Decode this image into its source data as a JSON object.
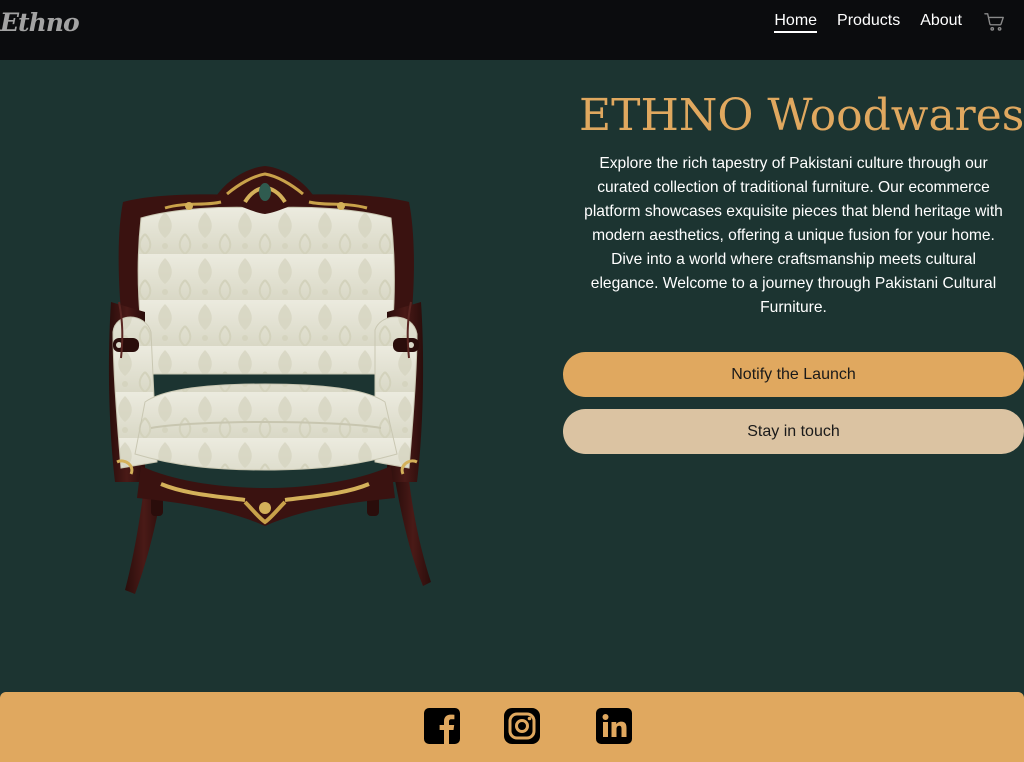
{
  "nav": {
    "logo": "Ethno",
    "links": [
      {
        "label": "Home",
        "active": true
      },
      {
        "label": "Products",
        "active": false
      },
      {
        "label": "About",
        "active": false
      }
    ],
    "cart_icon": "cart-icon"
  },
  "hero": {
    "title": "ETHNO Woodwares",
    "description": "Explore the rich tapestry of Pakistani culture through our curated collection of traditional furniture. Our ecommerce platform showcases exquisite pieces that blend heritage with modern aesthetics, offering a unique fusion for your home. Dive into a world where craftsmanship meets cultural elegance. Welcome to a journey through Pakistani Cultural Furniture.",
    "image_subject": "ornate-armchair",
    "buttons": {
      "notify": "Notify the Launch",
      "touch": "Stay in touch"
    }
  },
  "footer": {
    "socials": [
      "facebook-icon",
      "instagram-icon",
      "linkedin-icon"
    ]
  },
  "colors": {
    "nav_bg": "#0b0c0e",
    "page_bg": "#1c3431",
    "accent": "#e0a85f",
    "button_secondary": "#dbc3a2",
    "text_light": "#ffffff",
    "logo": "#a3a3a3"
  }
}
